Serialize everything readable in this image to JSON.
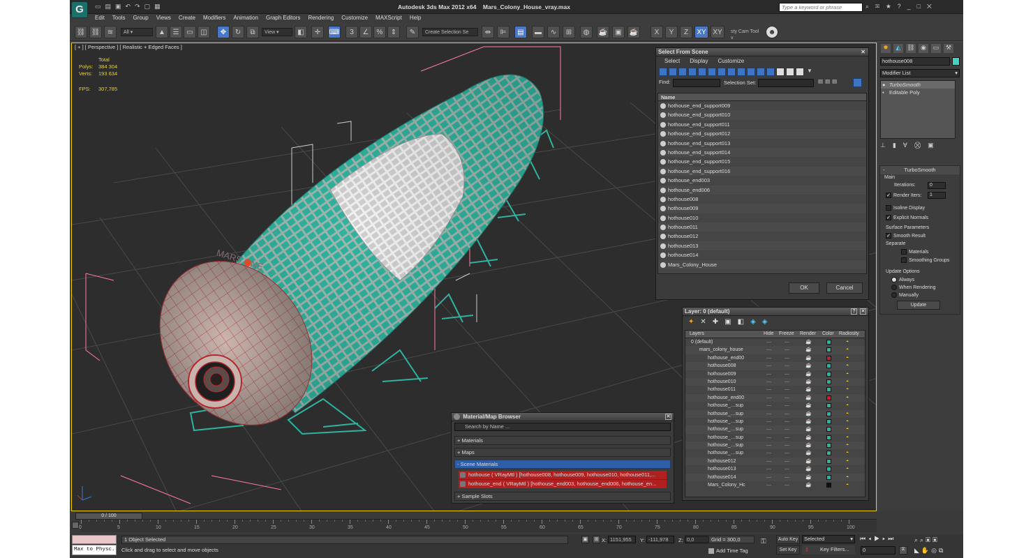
{
  "app": {
    "title": "Autodesk 3ds Max  2012 x64",
    "file": "Mars_Colony_House_vray.max",
    "search_placeholder": "Type a keyword or phrase"
  },
  "menu": [
    "Edit",
    "Tools",
    "Group",
    "Views",
    "Create",
    "Modifiers",
    "Animation",
    "Graph Editors",
    "Rendering",
    "Customize",
    "MAXScript",
    "Help"
  ],
  "toolbar": {
    "filter_value": "All",
    "coord_value": "View",
    "selection_set_placeholder": "Create Selection Se",
    "axes": [
      "X",
      "Y",
      "Z",
      "XY",
      "XY"
    ],
    "camera_tool": "sty Cam Tool v"
  },
  "viewport": {
    "label": "[ + ] [ Perspective ] [ Realistic + Edged Faces ]",
    "stats": {
      "total_label": "Total",
      "polys_label": "Polys:",
      "polys": "384 304",
      "verts_label": "Verts:",
      "verts": "193 634",
      "fps_label": "FPS:",
      "fps": "307,785"
    },
    "logo_text": "MARS ONE",
    "colors": {
      "bg": "#2d2d2d",
      "mesh_green": "#2fb39f",
      "mesh_white": "#d8d8d8",
      "cap": "#c9b3ad",
      "wire_red": "#c0262b",
      "bbox_pink": "#ff7ca0"
    }
  },
  "select_from_scene": {
    "title": "Select From Scene",
    "menu": [
      "Select",
      "Display",
      "Customize"
    ],
    "find_label": "Find:",
    "selection_set_label": "Selection Set:",
    "column": "Name",
    "items": [
      "hothouse_end_support009",
      "hothouse_end_support010",
      "hothouse_end_support011",
      "hothouse_end_support012",
      "hothouse_end_support013",
      "hothouse_end_support014",
      "hothouse_end_support015",
      "hothouse_end_support016",
      "hothouse_end003",
      "hothouse_end006",
      "hothouse008",
      "hothouse009",
      "hothouse010",
      "hothouse011",
      "hothouse012",
      "hothouse013",
      "hothouse014",
      "Mars_Colony_House"
    ],
    "ok": "OK",
    "cancel": "Cancel"
  },
  "layer_panel": {
    "title": "Layer: 0 (default)",
    "columns": [
      "Layers",
      "Hide",
      "Freeze",
      "Render",
      "Color",
      "Radiosity"
    ],
    "rows": [
      {
        "name": "0 (default)",
        "indent": 0,
        "color": "#2fb3a0"
      },
      {
        "name": "mars_colony_house",
        "indent": 1,
        "color": "#2fb3a0"
      },
      {
        "name": "hothouse_end00",
        "indent": 2,
        "color": "#c8202a"
      },
      {
        "name": "hothouse008",
        "indent": 2,
        "color": "#2fb3a0"
      },
      {
        "name": "hothouse009",
        "indent": 2,
        "color": "#2fb3a0"
      },
      {
        "name": "hothouse010",
        "indent": 2,
        "color": "#2fb3a0"
      },
      {
        "name": "hothouse011",
        "indent": 2,
        "color": "#2fb3a0"
      },
      {
        "name": "hothouse_end00",
        "indent": 2,
        "color": "#c8202a"
      },
      {
        "name": "hothouse_…sup",
        "indent": 2,
        "color": "#2fb3a0"
      },
      {
        "name": "hothouse_…sup",
        "indent": 2,
        "color": "#2fb3a0"
      },
      {
        "name": "hothouse_…sup",
        "indent": 2,
        "color": "#2fb3a0"
      },
      {
        "name": "hothouse_…sup",
        "indent": 2,
        "color": "#2fb3a0"
      },
      {
        "name": "hothouse_…sup",
        "indent": 2,
        "color": "#2fb3a0"
      },
      {
        "name": "hothouse_…sup",
        "indent": 2,
        "color": "#2fb3a0"
      },
      {
        "name": "hothouse_…sup",
        "indent": 2,
        "color": "#2fb3a0"
      },
      {
        "name": "hothouse012",
        "indent": 2,
        "color": "#2fb3a0"
      },
      {
        "name": "hothouse013",
        "indent": 2,
        "color": "#2fb3a0"
      },
      {
        "name": "hothouse014",
        "indent": 2,
        "color": "#2fb3a0"
      },
      {
        "name": "Mars_Colony_Hc",
        "indent": 2,
        "color": "#111111"
      }
    ]
  },
  "material_browser": {
    "title": "Material/Map Browser",
    "search_placeholder": "Search by Name ...",
    "sections": {
      "materials": "+ Materials",
      "maps": "+ Maps",
      "scene": "- Scene Materials",
      "samples": "+ Sample Slots"
    },
    "scene_items": [
      "hothouse  ( VRayMtl ) [hothouse008, hothouse009, hothouse010, hothouse011,...",
      "hothouse_end  ( VRayMtl ) [hothouse_end003, hothouse_end006, hothouse_en..."
    ]
  },
  "command_panel": {
    "object_name": "hothouse008",
    "modifier_list": "Modifier List",
    "stack": [
      "TurboSmooth",
      "Editable Poly"
    ],
    "rollout_title": "TurboSmooth",
    "main_label": "Main",
    "iterations_label": "Iterations:",
    "iterations": "0",
    "render_iters_label": "Render Iters:",
    "render_iters": "1",
    "isoline": "Isoline Display",
    "explicit": "Explicit Normals",
    "surface_params": "Surface Parameters",
    "smooth_result": "Smooth Result",
    "separate": "Separate",
    "materials": "Materials",
    "smoothing_groups": "Smoothing Groups",
    "update_options": "Update Options",
    "always": "Always",
    "when_rendering": "When Rendering",
    "manually": "Manually",
    "update": "Update"
  },
  "timeline": {
    "frame": "0 / 100",
    "ticks": [
      "0",
      "5",
      "10",
      "15",
      "20",
      "25",
      "30",
      "35",
      "40",
      "45",
      "50",
      "55",
      "60",
      "65",
      "70",
      "75",
      "80",
      "85",
      "90",
      "95",
      "100"
    ]
  },
  "status": {
    "selected": "1 Object Selected",
    "prompt": "Click and drag to select and move objects",
    "script": "Max to Physc.",
    "x_label": "X:",
    "x": "1151,955",
    "y_label": "Y:",
    "y": "-111,978",
    "z_label": "Z:",
    "z": "0,0",
    "grid": "Grid = 300,0",
    "add_time_tag": "Add Time Tag",
    "auto_key": "Auto Key",
    "set_key": "Set Key",
    "selected_dropdown": "Selected",
    "key_filters": "Key Filters...",
    "frame_field": "0"
  }
}
